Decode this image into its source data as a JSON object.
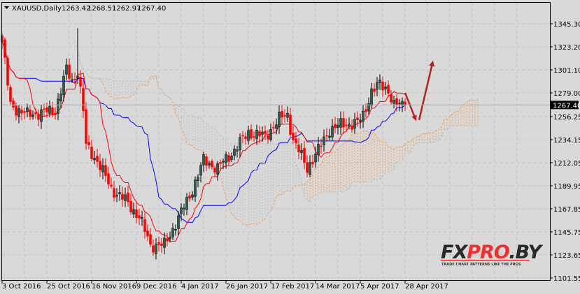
{
  "header": {
    "symbol": "XAUUSD,Daily",
    "open": "1263.42",
    "high": "1268.51",
    "low": "1262.97",
    "close": "1267.40"
  },
  "current_price_label": "1267.40",
  "logo": {
    "part1": "FX",
    "part2": "PRO",
    "part3": ".BY",
    "tagline": "TRADE CHART PATTERNS LIKE THE PROS"
  },
  "colors": {
    "background": "#d9d9d9",
    "bull": "#2e5e4e",
    "bear": "#ff0000",
    "tenkan": "#ff0000",
    "kijun": "#0000ff",
    "cloud_up": "#f4a460",
    "cloud_down": "#c0c0c0",
    "arrow": "#b22222",
    "grid": "#c4c4c4"
  },
  "chart_data": {
    "type": "candlestick",
    "title": "XAUUSD,Daily",
    "indicator": "Ichimoku Kinko Hyo (9,26,52)",
    "ylim": [
      1101.55,
      1356
    ],
    "y_ticks": [
      "1345.30",
      "1323.20",
      "1301.10",
      "1279.00",
      "1256.25",
      "1234.15",
      "1212.05",
      "1189.95",
      "1167.85",
      "1145.75",
      "1123.65",
      "1101.55"
    ],
    "y_tick_values": [
      1345.3,
      1323.2,
      1301.1,
      1279.0,
      1256.25,
      1234.15,
      1212.05,
      1189.95,
      1167.85,
      1145.75,
      1123.65,
      1101.55
    ],
    "x_ticks": [
      "3 Oct 2016",
      "25 Oct 2016",
      "16 Nov 2016",
      "9 Dec 2016",
      "4 Jan 2017",
      "26 Jan 2017",
      "17 Feb 2017",
      "14 Mar 2017",
      "5 Apr 2017",
      "28 Apr 2017"
    ],
    "x_tick_bar_interval": 16,
    "bar_count": 145,
    "close_anchors": [
      [
        0,
        1328
      ],
      [
        3,
        1267
      ],
      [
        9,
        1258
      ],
      [
        19,
        1262
      ],
      [
        23,
        1301
      ],
      [
        25,
        1290
      ],
      [
        27,
        1300
      ],
      [
        29,
        1262
      ],
      [
        30,
        1228
      ],
      [
        34,
        1214
      ],
      [
        39,
        1187
      ],
      [
        44,
        1176
      ],
      [
        49,
        1160
      ],
      [
        53,
        1133
      ],
      [
        58,
        1133
      ],
      [
        62,
        1154
      ],
      [
        67,
        1180
      ],
      [
        72,
        1214
      ],
      [
        77,
        1207
      ],
      [
        82,
        1221
      ],
      [
        88,
        1241
      ],
      [
        94,
        1237
      ],
      [
        99,
        1254
      ],
      [
        102,
        1258
      ],
      [
        104,
        1234
      ],
      [
        109,
        1207
      ],
      [
        113,
        1224
      ],
      [
        117,
        1244
      ],
      [
        122,
        1249
      ],
      [
        127,
        1250
      ],
      [
        129,
        1257
      ],
      [
        132,
        1281
      ],
      [
        135,
        1287
      ],
      [
        138,
        1282
      ],
      [
        140,
        1267
      ],
      [
        144,
        1267.4
      ]
    ],
    "current_price": 1267.4,
    "annotations": [
      {
        "type": "arrow",
        "from": [
          144,
          1279
        ],
        "to": [
          148,
          1252
        ]
      },
      {
        "type": "arrow",
        "from": [
          149,
          1253
        ],
        "to": [
          154,
          1310
        ]
      }
    ]
  }
}
